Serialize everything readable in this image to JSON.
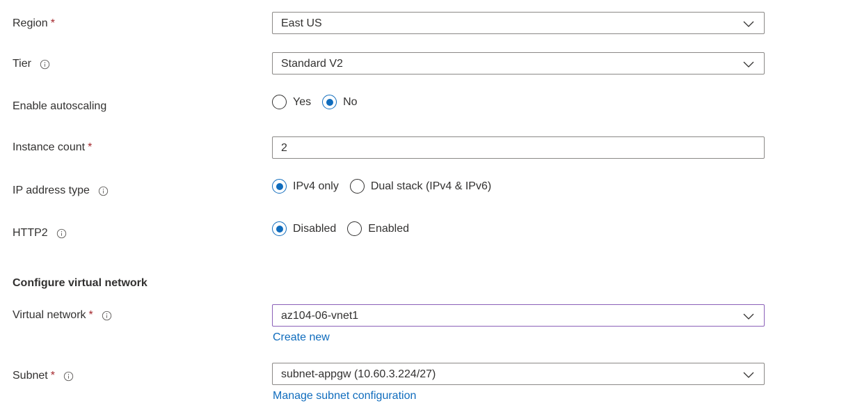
{
  "colors": {
    "accent": "#0f6cbd",
    "required": "#a4262c",
    "focus_border": "#8a5fb8"
  },
  "region": {
    "label": "Region",
    "required": "*",
    "value": "East US"
  },
  "tier": {
    "label": "Tier",
    "value": "Standard V2",
    "icon": "info-icon"
  },
  "autoscaling": {
    "label": "Enable autoscaling",
    "options": [
      "Yes",
      "No"
    ],
    "selected": "No"
  },
  "instance_count": {
    "label": "Instance count",
    "required": "*",
    "value": "2"
  },
  "ip_address_type": {
    "label": "IP address type",
    "options": [
      "IPv4 only",
      "Dual stack (IPv4 & IPv6)"
    ],
    "selected": "IPv4 only"
  },
  "http2": {
    "label": "HTTP2",
    "options": [
      "Disabled",
      "Enabled"
    ],
    "selected": "Disabled"
  },
  "vnet_section": {
    "title": "Configure virtual network"
  },
  "virtual_network": {
    "label": "Virtual network",
    "required": "*",
    "value": "az104-06-vnet1",
    "link": "Create new"
  },
  "subnet": {
    "label": "Subnet",
    "required": "*",
    "value": "subnet-appgw (10.60.3.224/27)",
    "link": "Manage subnet configuration"
  }
}
